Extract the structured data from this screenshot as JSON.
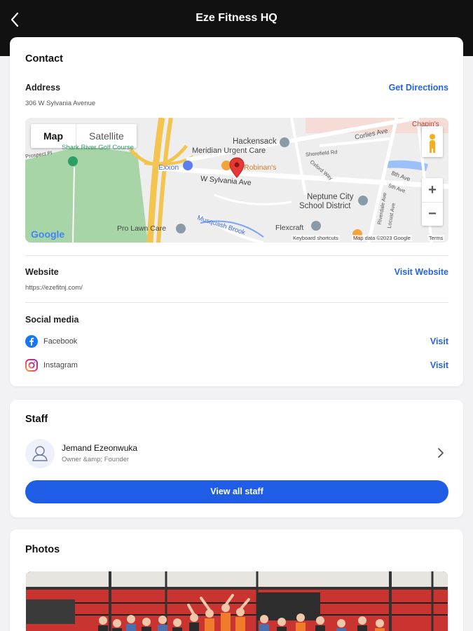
{
  "header": {
    "title": "Eze Fitness HQ",
    "back_icon": "chevron-left-icon"
  },
  "contact": {
    "title": "Contact",
    "address_label": "Address",
    "address_value": "306 W Sylvania Avenue",
    "directions_label": "Get Directions",
    "map": {
      "tab_map": "Map",
      "tab_satellite": "Satellite",
      "labels": [
        "Hackensack",
        "Meridian Urgent Care",
        "Exxon",
        "Robinan's",
        "W Sylvania Ave",
        "Neptune City",
        "School District",
        "Pro Lawn Care",
        "Musquash Brook",
        "Flexcraft",
        "Corlies Ave",
        "Shorefield Rd",
        "Oxford Way",
        "8th Ave",
        "5th Ave",
        "Riverdale Ave",
        "Locust Ave",
        "Prospect Pl",
        "Chapin's",
        "Shark River Golf Course"
      ],
      "logo": "Google",
      "shortcuts": "Keyboard shortcuts",
      "mapdata": "Map data ©2023 Google",
      "terms": "Terms",
      "zoom_in": "+",
      "zoom_out": "−"
    },
    "website_label": "Website",
    "website_value": "https://ezefitnj.com/",
    "website_link": "Visit Website",
    "social_label": "Social media",
    "social": [
      {
        "name": "Facebook",
        "link": "Visit",
        "icon": "facebook-icon"
      },
      {
        "name": "Instagram",
        "link": "Visit",
        "icon": "instagram-icon"
      }
    ]
  },
  "staff": {
    "title": "Staff",
    "members": [
      {
        "name": "Jemand Ezeonwuka",
        "role": "Owner &amp; Founder"
      }
    ],
    "button": "View all staff"
  },
  "photos": {
    "title": "Photos"
  },
  "colors": {
    "accent": "#1f5de6",
    "link": "#2563eb",
    "topbar": "#111111"
  }
}
